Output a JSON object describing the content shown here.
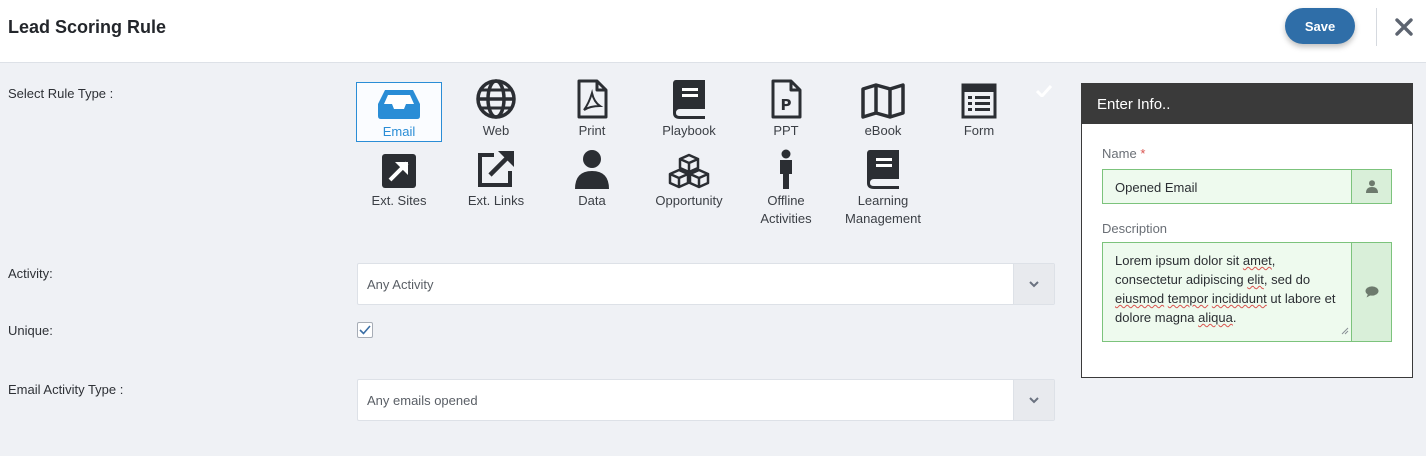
{
  "header": {
    "title": "Lead Scoring Rule",
    "save_label": "Save"
  },
  "labels": {
    "rule_type": "Select Rule Type :",
    "activity": "Activity:",
    "unique": "Unique:",
    "email_activity_type": "Email Activity Type :"
  },
  "rule_types": [
    {
      "label": "Email",
      "icon": "inbox-icon",
      "selected": true
    },
    {
      "label": "Web",
      "icon": "globe-icon"
    },
    {
      "label": "Print",
      "icon": "pdf-file-icon"
    },
    {
      "label": "Playbook",
      "icon": "book-icon"
    },
    {
      "label": "PPT",
      "icon": "ppt-file-icon"
    },
    {
      "label": "eBook",
      "icon": "map-icon"
    },
    {
      "label": "Form",
      "icon": "form-icon"
    },
    {
      "label": "Ext. Sites",
      "icon": "arrow-square-icon"
    },
    {
      "label": "Ext. Links",
      "icon": "external-link-icon"
    },
    {
      "label": "Data",
      "icon": "user-icon"
    },
    {
      "label": "Opportunity",
      "icon": "cubes-icon"
    },
    {
      "label": "Offline Activities",
      "icon": "person-icon"
    },
    {
      "label": "Learning Management",
      "icon": "book-icon"
    }
  ],
  "activity": {
    "value": "Any Activity"
  },
  "unique": {
    "checked": true
  },
  "email_activity_type": {
    "value": "Any emails opened"
  },
  "info_panel": {
    "title": "Enter Info..",
    "name_label": "Name",
    "name_required": "*",
    "name_value": "Opened Email",
    "description_label": "Description",
    "description_value": "Lorem ipsum dolor sit amet, consectetur adipiscing elit, sed do eiusmod tempor incididunt ut labore et dolore magna aliqua."
  },
  "colors": {
    "primary": "#2f6ea8",
    "selected": "#2a8dd6",
    "valid_border": "#7cc37c",
    "valid_bg": "#eefaee"
  }
}
